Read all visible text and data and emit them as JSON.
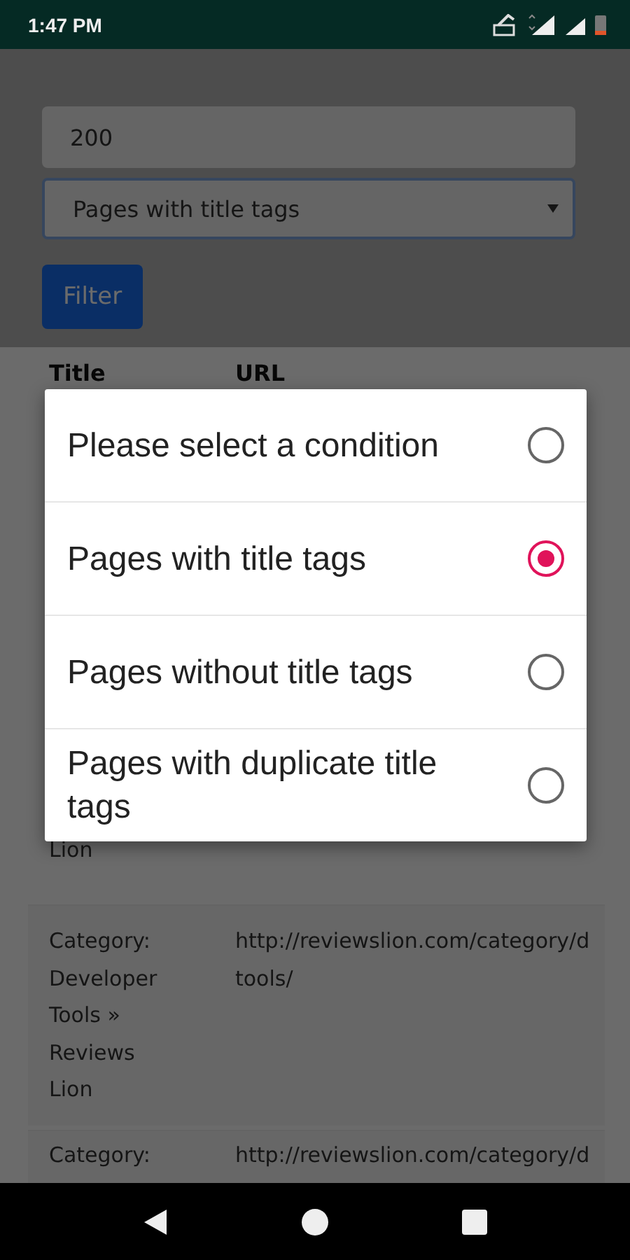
{
  "status_bar": {
    "time": "1:47 PM"
  },
  "filter": {
    "value": "200",
    "condition": "Pages with title tags",
    "button": "Filter"
  },
  "table": {
    "columns": [
      "Title",
      "URL"
    ],
    "rows": [
      {
        "title_lines": [
          "Lion"
        ],
        "url_lines": []
      },
      {
        "title_lines": [
          "Category:",
          "Developer",
          "Tools »",
          "Reviews",
          "Lion"
        ],
        "url_lines": [
          "http://reviewslion.com/category/d",
          "tools/"
        ]
      },
      {
        "title_lines": [
          "Category:"
        ],
        "url_lines": [
          "http://reviewslion.com/category/d"
        ]
      }
    ]
  },
  "dialog": {
    "options": [
      {
        "label": "Please select a condition",
        "selected": false
      },
      {
        "label": "Pages with title tags",
        "selected": true
      },
      {
        "label": "Pages without title tags",
        "selected": false
      },
      {
        "label": "Pages with duplicate title tags",
        "selected": false
      }
    ]
  }
}
